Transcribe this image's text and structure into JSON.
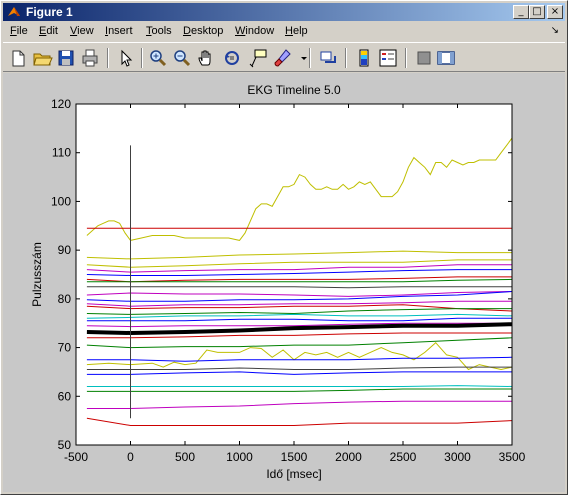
{
  "window": {
    "title": "Figure 1",
    "controls": [
      "_",
      "□",
      "×"
    ]
  },
  "menu": {
    "items": [
      {
        "label": "File",
        "accel": "F",
        "rest": "ile"
      },
      {
        "label": "Edit",
        "accel": "E",
        "rest": "dit"
      },
      {
        "label": "View",
        "accel": "V",
        "rest": "iew"
      },
      {
        "label": "Insert",
        "accel": "I",
        "rest": "nsert"
      },
      {
        "label": "Tools",
        "accel": "T",
        "rest": "ools"
      },
      {
        "label": "Desktop",
        "accel": "D",
        "rest": "esktop"
      },
      {
        "label": "Window",
        "accel": "W",
        "rest": "indow"
      },
      {
        "label": "Help",
        "accel": "H",
        "rest": "elp"
      }
    ],
    "dock_arrow": "↘"
  },
  "toolbar": {
    "icons": [
      "new-figure-icon",
      "open-file-icon",
      "save-icon",
      "print-icon",
      "select-arrow-icon",
      "zoom-in-icon",
      "zoom-out-icon",
      "pan-hand-icon",
      "rotate-3d-icon",
      "data-cursor-icon",
      "brush-icon",
      "link-plot-icon",
      "colorbar-icon",
      "legend-icon",
      "hide-plot-tools-icon",
      "show-plot-tools-icon"
    ]
  },
  "colors": {
    "red": "#cc0000",
    "yellow": "#bfbf00",
    "magenta": "#bf00bf",
    "green": "#008000",
    "blue": "#0000ff",
    "cyan": "#00bfbf",
    "darkgray": "#404040",
    "black": "#000000"
  },
  "chart_data": {
    "type": "line",
    "title": "EKG Timeline 5.0",
    "xlabel": "Idő [msec]",
    "ylabel": "Pulzusszám",
    "xlim": [
      -500,
      3500
    ],
    "ylim": [
      50,
      120
    ],
    "xticks": [
      -500,
      0,
      500,
      1000,
      1500,
      2000,
      2500,
      3000,
      3500
    ],
    "yticks": [
      50,
      60,
      70,
      80,
      90,
      100,
      110,
      120
    ],
    "grid": false,
    "marker_line": {
      "x": 0,
      "y": [
        55.5,
        111.5
      ]
    },
    "series": [
      {
        "color": "#bfbf00",
        "width": 1,
        "x": [
          -400,
          -300,
          -250,
          -200,
          -150,
          -100,
          -50,
          0,
          100,
          200,
          300,
          400,
          500,
          600,
          700,
          800,
          900,
          1000,
          1050,
          1100,
          1150,
          1200,
          1250,
          1300,
          1350,
          1400,
          1450,
          1500,
          1550,
          1600,
          1650,
          1700,
          1750,
          1800,
          1850,
          1900,
          1950,
          2000,
          2050,
          2100,
          2150,
          2200,
          2250,
          2300,
          2350,
          2400,
          2450,
          2500,
          2550,
          2600,
          2650,
          2700,
          2750,
          2800,
          2850,
          2900,
          2950,
          3000,
          3050,
          3100,
          3150,
          3200,
          3250,
          3300,
          3350,
          3400,
          3450,
          3500
        ],
        "y": [
          93,
          95,
          95.5,
          96,
          96,
          95.5,
          93.5,
          92,
          92.5,
          93,
          93,
          93,
          92.5,
          92.5,
          92.5,
          92.5,
          92.5,
          92,
          93.5,
          96,
          98.5,
          99.5,
          99.5,
          99,
          101,
          103,
          103,
          103.5,
          105.5,
          105,
          103.5,
          102.5,
          102.5,
          103,
          102.5,
          102.5,
          103.5,
          102.5,
          103,
          104,
          103.5,
          104,
          102.5,
          101,
          101,
          101,
          102,
          104,
          107,
          109,
          108,
          107,
          105.5,
          108,
          108,
          107,
          108.5,
          108,
          107.5,
          108,
          108,
          108.5,
          108.5,
          108.5,
          108.5,
          110,
          111.5,
          113
        ]
      },
      {
        "color": "#cc0000",
        "width": 1,
        "x": [
          -400,
          3500
        ],
        "y": [
          94.5,
          94.5
        ]
      },
      {
        "color": "#bfbf00",
        "width": 1,
        "x": [
          -400,
          0,
          500,
          1000,
          1500,
          2000,
          2500,
          3000,
          3500
        ],
        "y": [
          88.5,
          88.2,
          88.5,
          89,
          89.2,
          89.5,
          89.8,
          89.5,
          89.5
        ]
      },
      {
        "color": "#bfbf00",
        "width": 1,
        "x": [
          -400,
          0,
          500,
          1000,
          1500,
          2000,
          2500,
          3000,
          3500
        ],
        "y": [
          87,
          86.5,
          86.8,
          87.2,
          87.5,
          87.5,
          87.5,
          88,
          88
        ]
      },
      {
        "color": "#bf00bf",
        "width": 1,
        "x": [
          -400,
          0,
          500,
          1000,
          1500,
          2000,
          2500,
          3000,
          3500
        ],
        "y": [
          86,
          85.5,
          85.8,
          86,
          86,
          86.5,
          86.5,
          87,
          87
        ]
      },
      {
        "color": "#0000ff",
        "width": 1,
        "x": [
          -400,
          0,
          500,
          1000,
          1500,
          2000,
          2500,
          3000,
          3500
        ],
        "y": [
          85,
          84.8,
          84.8,
          85,
          85.2,
          85.5,
          85.8,
          86,
          86
        ]
      },
      {
        "color": "#cc0000",
        "width": 1,
        "x": [
          -400,
          0,
          500,
          1000,
          1500,
          2000,
          2500,
          3000,
          3500
        ],
        "y": [
          84,
          83.5,
          83.8,
          84,
          84,
          84,
          84.2,
          84.5,
          84.5
        ]
      },
      {
        "color": "#008000",
        "width": 1,
        "x": [
          -400,
          0,
          500,
          1000,
          1500,
          2000,
          2500,
          3000,
          3500
        ],
        "y": [
          83.5,
          83.5,
          83.5,
          83.5,
          83.5,
          83.5,
          83.5,
          83.8,
          84
        ]
      },
      {
        "color": "#404040",
        "width": 1,
        "x": [
          -400,
          0,
          500,
          1000,
          1500,
          2000,
          2500,
          3000,
          3500
        ],
        "y": [
          82.5,
          82.5,
          82.5,
          82.5,
          82.5,
          82.3,
          82.5,
          82.5,
          82.5
        ]
      },
      {
        "color": "#bf00bf",
        "width": 1,
        "x": [
          -400,
          0,
          500,
          1000,
          1500,
          2000,
          2500,
          3000,
          3500
        ],
        "y": [
          80.8,
          81.2,
          81,
          81,
          80.8,
          80.5,
          80.8,
          81.3,
          81.5
        ]
      },
      {
        "color": "#0000ff",
        "width": 1,
        "x": [
          -400,
          0,
          500,
          1000,
          1500,
          2000,
          2500,
          3000,
          3500
        ],
        "y": [
          79.8,
          79.5,
          79.5,
          79.8,
          79.8,
          80,
          80.5,
          80.8,
          81.5
        ]
      },
      {
        "color": "#bf00bf",
        "width": 1,
        "x": [
          -400,
          0,
          500,
          1000,
          1500,
          2000,
          2500,
          3000,
          3500
        ],
        "y": [
          79,
          78.5,
          78.8,
          78.8,
          79,
          79,
          79.2,
          79.5,
          79.5
        ]
      },
      {
        "color": "#cc0000",
        "width": 1,
        "x": [
          -400,
          0,
          500,
          1000,
          1500,
          2000,
          2500,
          3000,
          3500
        ],
        "y": [
          78.5,
          78,
          78.2,
          78.2,
          78.5,
          78.5,
          78.8,
          78,
          77.5
        ]
      },
      {
        "color": "#008000",
        "width": 1,
        "x": [
          -400,
          0,
          500,
          1000,
          1500,
          2000,
          2500,
          3000,
          3500
        ],
        "y": [
          77,
          76.8,
          77,
          77.2,
          77,
          77.5,
          77.8,
          78,
          78
        ]
      },
      {
        "color": "#00bfbf",
        "width": 1,
        "x": [
          -400,
          0,
          500,
          1000,
          1500,
          2000,
          2500,
          3000,
          3500
        ],
        "y": [
          76,
          76.2,
          76.5,
          76.5,
          76.8,
          76.5,
          76.5,
          76.8,
          76.5
        ]
      },
      {
        "color": "#0000ff",
        "width": 1,
        "x": [
          -400,
          0,
          500,
          1000,
          1500,
          2000,
          2500,
          3000,
          3500
        ],
        "y": [
          75.5,
          75.5,
          75.5,
          75.8,
          75.8,
          75.5,
          75.5,
          76,
          76
        ]
      },
      {
        "color": "#bf00bf",
        "width": 1,
        "x": [
          -400,
          0,
          500,
          1000,
          1500,
          2000,
          2500,
          3000,
          3500
        ],
        "y": [
          74.5,
          74.3,
          74.5,
          74.5,
          74.5,
          74.8,
          75,
          75,
          75
        ]
      },
      {
        "color": "#000000",
        "width": 4,
        "x": [
          -400,
          0,
          500,
          1000,
          1500,
          2000,
          2500,
          3000,
          3500
        ],
        "y": [
          73.2,
          73,
          73.2,
          73.5,
          74,
          74.2,
          74.5,
          74.5,
          74.8
        ]
      },
      {
        "color": "#cc0000",
        "width": 1,
        "x": [
          -400,
          0,
          500,
          1000,
          1500,
          2000,
          2500,
          3000,
          3500
        ],
        "y": [
          72,
          72,
          72.2,
          72.5,
          72.5,
          72.8,
          73,
          73,
          73
        ]
      },
      {
        "color": "#008000",
        "width": 1,
        "x": [
          -400,
          0,
          500,
          1000,
          1500,
          2000,
          2500,
          3000,
          3500
        ],
        "y": [
          70.5,
          70,
          70.2,
          70.2,
          70.5,
          70.5,
          71,
          71.5,
          72
        ]
      },
      {
        "color": "#bfbf00",
        "width": 1,
        "x": [
          -400,
          -200,
          0,
          200,
          300,
          400,
          500,
          600,
          700,
          800,
          900,
          1000,
          1100,
          1200,
          1300,
          1400,
          1500,
          1600,
          1700,
          1800,
          1900,
          2000,
          2100,
          2200,
          2300,
          2400,
          2500,
          2600,
          2700,
          2800,
          2900,
          3000,
          3100,
          3200,
          3300,
          3400,
          3500
        ],
        "y": [
          66.5,
          66.8,
          66.5,
          66.8,
          66,
          67,
          66.5,
          66.8,
          69.5,
          69,
          69,
          69,
          70,
          69.8,
          68,
          69.5,
          67.5,
          69,
          68.5,
          69,
          68,
          69,
          68,
          69,
          70,
          69,
          68.5,
          67.5,
          69,
          71,
          68.5,
          68,
          65.5,
          66.5,
          66,
          65.5,
          66
        ]
      },
      {
        "color": "#0000ff",
        "width": 1,
        "x": [
          -400,
          0,
          500,
          1000,
          1500,
          2000,
          2500,
          3000,
          3500
        ],
        "y": [
          67.5,
          67.5,
          67.2,
          67.5,
          67.5,
          67.5,
          67.8,
          67.8,
          68
        ]
      },
      {
        "color": "#404040",
        "width": 1,
        "x": [
          -400,
          0,
          500,
          1000,
          1500,
          2000,
          2500,
          3000,
          3500
        ],
        "y": [
          65.5,
          65.5,
          65.5,
          65.8,
          65.5,
          65.5,
          65.8,
          66,
          66
        ]
      },
      {
        "color": "#0000ff",
        "width": 1,
        "x": [
          -400,
          0,
          500,
          1000,
          1500,
          2000,
          2500,
          3000,
          3500
        ],
        "y": [
          64.5,
          64.5,
          64.8,
          65,
          64.5,
          64.8,
          65,
          65,
          65
        ]
      },
      {
        "color": "#00bfbf",
        "width": 1,
        "x": [
          -400,
          0,
          500,
          1000,
          1500,
          2000,
          2500,
          3000,
          3500
        ],
        "y": [
          62,
          62,
          62,
          62,
          62,
          62,
          62,
          62.2,
          62
        ]
      },
      {
        "color": "#008000",
        "width": 1,
        "x": [
          -400,
          0,
          500,
          1000,
          1500,
          2000,
          2500,
          3000,
          3500
        ],
        "y": [
          61,
          61,
          61,
          61,
          61,
          61.2,
          61.5,
          61.5,
          61.5
        ]
      },
      {
        "color": "#bf00bf",
        "width": 1,
        "x": [
          -400,
          0,
          500,
          1000,
          1500,
          2000,
          2500,
          3000,
          3500
        ],
        "y": [
          57.5,
          57.5,
          57.8,
          58,
          58.5,
          58.8,
          59,
          59,
          59
        ]
      },
      {
        "color": "#cc0000",
        "width": 1,
        "x": [
          -400,
          0,
          500,
          1000,
          1500,
          2000,
          2500,
          3000,
          3500
        ],
        "y": [
          55.5,
          54,
          54,
          54,
          54,
          54.5,
          54.5,
          54.5,
          55
        ]
      }
    ]
  }
}
